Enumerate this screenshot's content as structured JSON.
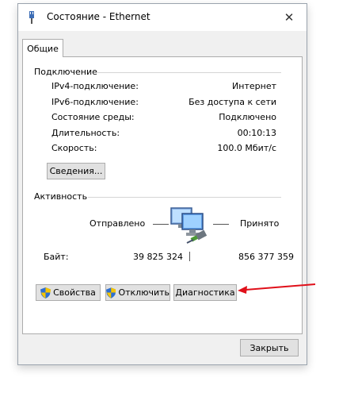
{
  "window": {
    "title": "Состояние - Ethernet",
    "close_glyph": "✕"
  },
  "tabs": [
    {
      "label": "Общие"
    }
  ],
  "connection": {
    "group_label": "Подключение",
    "rows": [
      {
        "label": "IPv4-подключение:",
        "value": "Интернет"
      },
      {
        "label": "IPv6-подключение:",
        "value": "Без доступа к сети"
      },
      {
        "label": "Состояние среды:",
        "value": "Подключено"
      },
      {
        "label": "Длительность:",
        "value": "00:10:13"
      },
      {
        "label": "Скорость:",
        "value": "100.0 Мбит/с"
      }
    ],
    "details_button": "Сведения..."
  },
  "activity": {
    "group_label": "Активность",
    "sent_label": "Отправлено",
    "received_label": "Принято",
    "bytes_label": "Байт:",
    "bytes_sent": "39 825 324",
    "bytes_received": "856 377 359"
  },
  "actions": {
    "properties": "Свойства",
    "disable": "Отключить",
    "diagnose": "Диагностика"
  },
  "footer": {
    "close": "Закрыть"
  },
  "icons": {
    "title": "network-plug-icon",
    "shield": "uac-shield-icon",
    "network": "network-computers-icon",
    "annotation": "red-arrow"
  },
  "colors": {
    "annotation_arrow": "#e0101a",
    "shield_blue": "#2e6fd0",
    "shield_yellow": "#f5c400"
  }
}
